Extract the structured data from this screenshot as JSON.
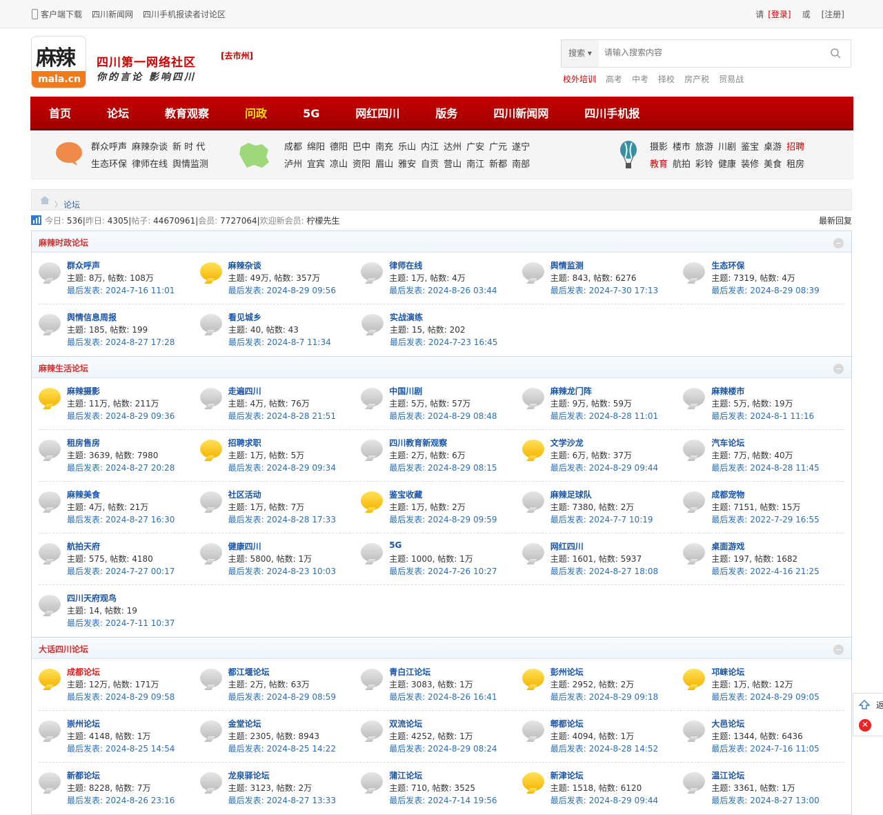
{
  "topbar": {
    "links": [
      "客户端下载",
      "四川新闻网",
      "四川手机报读者讨论区"
    ],
    "please": "请",
    "login": "[登录]",
    "or": "或",
    "register": "[注册]"
  },
  "logo": {
    "zh": "麻辣",
    "en": "mala.cn"
  },
  "slogan": {
    "line1": "四川第一网络社区",
    "line2": "你的言论 影响四川"
  },
  "city": "[去市州]",
  "search": {
    "type": "搜索",
    "placeholder": "请输入搜索内容"
  },
  "hot": [
    "校外培训",
    "高考",
    "中考",
    "择校",
    "房产税",
    "贸易战"
  ],
  "nav": [
    "首页",
    "论坛",
    "教育观察",
    "问政",
    "5G",
    "网红四川",
    "版务",
    "四川新闻网",
    "四川手机报"
  ],
  "nav_active": 3,
  "subnav": {
    "a": [
      [
        "群众呼声",
        "麻辣杂谈",
        "新 时 代"
      ],
      [
        "生态环保",
        "律师在线",
        "舆情监测"
      ]
    ],
    "b": [
      [
        "成都",
        "绵阳",
        "德阳",
        "巴中",
        "南充",
        "乐山",
        "内江",
        "达州",
        "广安",
        "广元",
        "遂宁"
      ],
      [
        "泸州",
        "宜宾",
        "凉山",
        "资阳",
        "眉山",
        "雅安",
        "自贡",
        "营山",
        "南江",
        "新都",
        "南部"
      ]
    ],
    "c": [
      [
        "摄影",
        "楼市",
        "旅游",
        "川剧",
        "鉴宝",
        "桌游",
        "招聘"
      ],
      [
        "教育",
        "航拍",
        "彩铃",
        "健康",
        "装修",
        "美食",
        "租房"
      ]
    ]
  },
  "crumb": "论坛",
  "stats": {
    "today_k": "今日:",
    "today": "536",
    "yest_k": "昨日:",
    "yest": "4305",
    "posts_k": "帖子:",
    "posts": "44670961",
    "members_k": "会员:",
    "members": "7727064",
    "welcome": "欢迎新会员:",
    "newest": "柠檬先生",
    "recent": "最新回复"
  },
  "sections": [
    {
      "title": "麻辣时政论坛",
      "rows": [
        [
          {
            "n": "群众呼声",
            "c": "主题: 8万, 帖数: 108万",
            "l": "最后发表: 2024-7-16 11:01",
            "new": false
          },
          {
            "n": "麻辣杂谈",
            "c": "主题: 49万, 帖数: 357万",
            "l": "最后发表: 2024-8-29 09:56",
            "new": true
          },
          {
            "n": "律师在线",
            "c": "主题: 1万, 帖数: 4万",
            "l": "最后发表: 2024-8-26 03:44",
            "new": false
          },
          {
            "n": "舆情监测",
            "c": "主题: 843, 帖数: 6276",
            "l": "最后发表: 2024-7-30 17:13",
            "new": false
          },
          {
            "n": "生态环保",
            "c": "主题: 7319, 帖数: 4万",
            "l": "最后发表: 2024-8-29 08:39",
            "new": false
          }
        ],
        [
          {
            "n": "舆情信息周报",
            "c": "主题: 185, 帖数: 199",
            "l": "最后发表: 2024-8-27 17:28",
            "new": false
          },
          {
            "n": "看见城乡",
            "c": "主题: 40, 帖数: 43",
            "l": "最后发表: 2024-8-7 11:34",
            "new": false
          },
          {
            "n": "实战演练",
            "c": "主题: 15, 帖数: 202",
            "l": "最后发表: 2024-7-23 16:45",
            "new": false
          }
        ]
      ]
    },
    {
      "title": "麻辣生活论坛",
      "rows": [
        [
          {
            "n": "麻辣摄影",
            "c": "主题: 11万, 帖数: 211万",
            "l": "最后发表: 2024-8-29 09:36",
            "new": true
          },
          {
            "n": "走遍四川",
            "c": "主题: 4万, 帖数: 76万",
            "l": "最后发表: 2024-8-28 21:51",
            "new": false
          },
          {
            "n": "中国川剧",
            "c": "主题: 5万, 帖数: 57万",
            "l": "最后发表: 2024-8-29 08:48",
            "new": false
          },
          {
            "n": "麻辣龙门阵",
            "c": "主题: 9万, 帖数: 59万",
            "l": "最后发表: 2024-8-28 11:01",
            "new": false
          },
          {
            "n": "麻辣楼市",
            "c": "主题: 5万, 帖数: 19万",
            "l": "最后发表: 2024-8-1 11:16",
            "new": false
          }
        ],
        [
          {
            "n": "租房售房",
            "c": "主题: 3639, 帖数: 7980",
            "l": "最后发表: 2024-8-27 20:28",
            "new": false
          },
          {
            "n": "招聘求职",
            "c": "主题: 1万, 帖数: 5万",
            "l": "最后发表: 2024-8-29 09:34",
            "new": true
          },
          {
            "n": "四川教育新观察",
            "c": "主题: 2万, 帖数: 6万",
            "l": "最后发表: 2024-8-29 08:15",
            "new": false
          },
          {
            "n": "文学沙龙",
            "c": "主题: 6万, 帖数: 37万",
            "l": "最后发表: 2024-8-29 09:44",
            "new": true
          },
          {
            "n": "汽车论坛",
            "c": "主题: 7万, 帖数: 40万",
            "l": "最后发表: 2024-8-28 11:45",
            "new": false
          }
        ],
        [
          {
            "n": "麻辣美食",
            "c": "主题: 4万, 帖数: 21万",
            "l": "最后发表: 2024-8-27 16:30",
            "new": false
          },
          {
            "n": "社区活动",
            "c": "主题: 1万, 帖数: 7万",
            "l": "最后发表: 2024-8-28 17:33",
            "new": false
          },
          {
            "n": "鉴宝收藏",
            "c": "主题: 1万, 帖数: 2万",
            "l": "最后发表: 2024-8-29 09:59",
            "new": true
          },
          {
            "n": "麻辣足球队",
            "c": "主题: 7380, 帖数: 2万",
            "l": "最后发表: 2024-7-7 10:19",
            "new": false
          },
          {
            "n": "成都宠物",
            "c": "主题: 7151, 帖数: 15万",
            "l": "最后发表: 2022-7-29 16:55",
            "new": false
          }
        ],
        [
          {
            "n": "航拍天府",
            "c": "主题: 575, 帖数: 4180",
            "l": "最后发表: 2024-7-27 00:17",
            "new": false
          },
          {
            "n": "健康四川",
            "c": "主题: 5800, 帖数: 1万",
            "l": "最后发表: 2024-8-23 10:03",
            "new": false
          },
          {
            "n": "5G",
            "c": "主题: 1000, 帖数: 1万",
            "l": "最后发表: 2024-7-26 10:27",
            "new": false
          },
          {
            "n": "网红四川",
            "c": "主题: 1601, 帖数: 5937",
            "l": "最后发表: 2024-8-27 18:08",
            "new": false
          },
          {
            "n": "桌面游戏",
            "c": "主题: 197, 帖数: 1682",
            "l": "最后发表: 2022-4-16 21:25",
            "new": false
          }
        ],
        [
          {
            "n": "四川天府观鸟",
            "c": "主题: 14, 帖数: 19",
            "l": "最后发表: 2024-7-11 10:37",
            "new": false
          }
        ]
      ]
    },
    {
      "title": "大话四川论坛",
      "rows": [
        [
          {
            "n": "成都论坛",
            "c": "主题: 12万, 帖数: 171万",
            "l": "最后发表: 2024-8-29 09:58",
            "new": true,
            "red": true
          },
          {
            "n": "都江堰论坛",
            "c": "主题: 2万, 帖数: 63万",
            "l": "最后发表: 2024-8-29 08:59",
            "new": false
          },
          {
            "n": "青白江论坛",
            "c": "主题: 3083, 帖数: 1万",
            "l": "最后发表: 2024-8-26 16:41",
            "new": false
          },
          {
            "n": "彭州论坛",
            "c": "主题: 2952, 帖数: 2万",
            "l": "最后发表: 2024-8-29 09:18",
            "new": true
          },
          {
            "n": "邛崃论坛",
            "c": "主题: 1万, 帖数: 12万",
            "l": "最后发表: 2024-8-29 09:05",
            "new": true
          }
        ],
        [
          {
            "n": "崇州论坛",
            "c": "主题: 4148, 帖数: 1万",
            "l": "最后发表: 2024-8-25 14:54",
            "new": false
          },
          {
            "n": "金堂论坛",
            "c": "主题: 2305, 帖数: 8943",
            "l": "最后发表: 2024-8-25 14:22",
            "new": false
          },
          {
            "n": "双流论坛",
            "c": "主题: 4252, 帖数: 1万",
            "l": "最后发表: 2024-8-29 08:24",
            "new": false
          },
          {
            "n": "郫都论坛",
            "c": "主题: 4094, 帖数: 1万",
            "l": "最后发表: 2024-8-28 14:52",
            "new": false
          },
          {
            "n": "大邑论坛",
            "c": "主题: 1344, 帖数: 6436",
            "l": "最后发表: 2024-7-16 11:05",
            "new": false
          }
        ],
        [
          {
            "n": "新都论坛",
            "c": "主题: 8228, 帖数: 7万",
            "l": "最后发表: 2024-8-26 23:16",
            "new": false
          },
          {
            "n": "龙泉驿论坛",
            "c": "主题: 3123, 帖数: 2万",
            "l": "最后发表: 2024-8-27 13:33",
            "new": false
          },
          {
            "n": "蒲江论坛",
            "c": "主题: 710, 帖数: 3525",
            "l": "最后发表: 2024-7-14 19:56",
            "new": false
          },
          {
            "n": "新津论坛",
            "c": "主题: 1518, 帖数: 6120",
            "l": "最后发表: 2024-8-29 09:44",
            "new": true
          },
          {
            "n": "温江论坛",
            "c": "主题: 3361, 帖数: 1万",
            "l": "最后发表: 2024-8-27 13:00",
            "new": false
          }
        ]
      ]
    }
  ],
  "floatbar": {
    "up": "返",
    "close": "✕"
  }
}
